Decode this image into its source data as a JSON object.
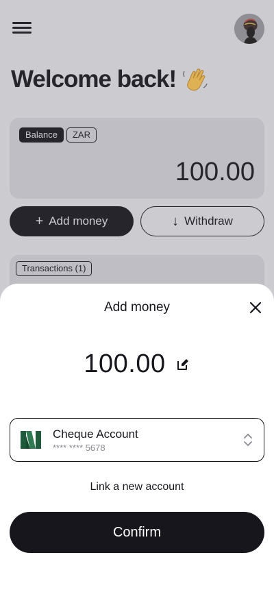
{
  "header": {
    "menu_icon": "hamburger-menu-icon",
    "avatar_icon": "user-avatar"
  },
  "welcome": {
    "title": "Welcome back!",
    "emoji_icon": "waving-hand-icon"
  },
  "balance": {
    "label": "Balance",
    "currency": "ZAR",
    "amount": "100.00"
  },
  "actions": {
    "add_money": {
      "icon": "+",
      "label": "Add money"
    },
    "withdraw": {
      "icon": "↓",
      "label": "Withdraw"
    }
  },
  "transactions": {
    "label": "Transactions (1)"
  },
  "sheet": {
    "title": "Add money",
    "amount": "100.00",
    "close_icon": "close-icon",
    "edit_icon": "edit-icon",
    "account": {
      "name": "Cheque Account",
      "number": "**** **** 5678",
      "logo_icon": "nedbank-logo-icon",
      "chevron_icon": "chevron-up-down-icon"
    },
    "link_account": "Link a new account",
    "confirm": "Confirm"
  },
  "colors": {
    "primary": "#17161d",
    "background": "#d4d3d8",
    "card": "#c5c4ca",
    "sheet": "#ffffff",
    "bank_green": "#1e5a3c"
  }
}
